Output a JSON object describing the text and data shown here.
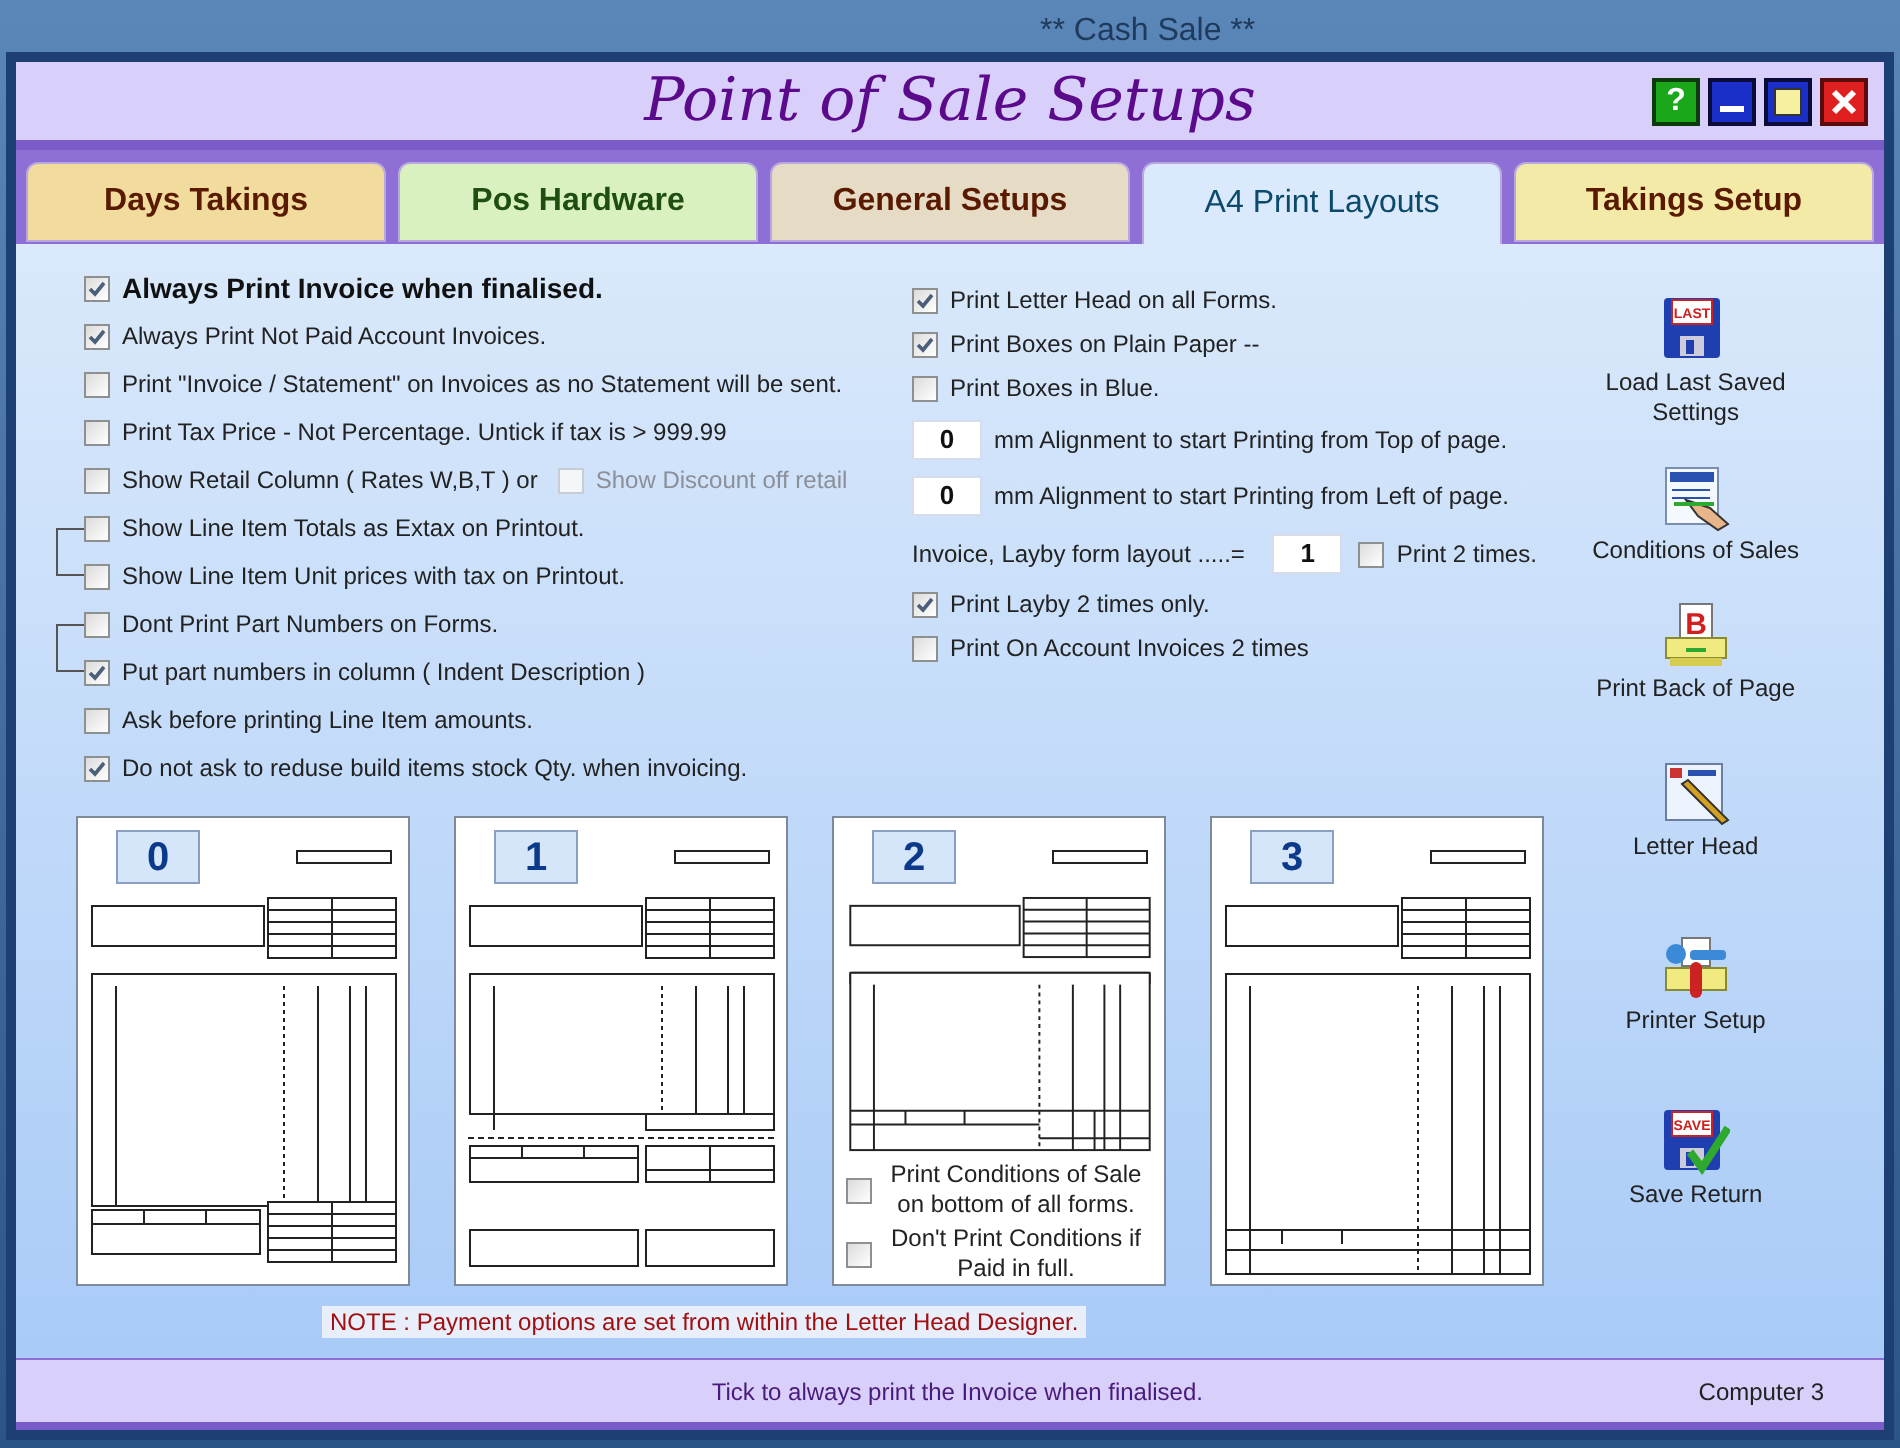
{
  "background_window": {
    "title": "** Cash Sale **"
  },
  "window": {
    "title": "Point of Sale Setups",
    "help_glyph": "?"
  },
  "tabs": [
    {
      "label": "Days Takings",
      "selected": false,
      "color": "#f1dc9e"
    },
    {
      "label": "Pos Hardware",
      "selected": false,
      "color": "#d9f0c0"
    },
    {
      "label": "General Setups",
      "selected": false,
      "color": "#e6dcc6"
    },
    {
      "label": "A4 Print Layouts",
      "selected": true,
      "color": "#dae9fb"
    },
    {
      "label": "Takings Setup",
      "selected": false,
      "color": "#f4eaa8"
    }
  ],
  "left_options": [
    {
      "kind": "heading",
      "label": "Always Print Invoice when finalised.",
      "checked": true
    },
    {
      "kind": "option",
      "label": "Always Print Not Paid Account Invoices.",
      "checked": true
    },
    {
      "kind": "option",
      "label": "Print \"Invoice / Statement\" on Invoices as no Statement will be sent.",
      "checked": false
    },
    {
      "kind": "option",
      "label": "Print Tax Price - Not Percentage.  Untick if tax is > 999.99",
      "checked": false
    },
    {
      "kind": "option",
      "label": "Show Retail Column ( Rates W,B,T ) or",
      "checked": false,
      "sub": {
        "label": "Show Discount off retail",
        "checked": false,
        "disabled": true
      }
    },
    {
      "kind": "linked",
      "options": [
        {
          "label": "Show Line Item Totals as Extax on Printout.",
          "checked": false
        },
        {
          "label": "Show Line Item Unit prices with tax on Printout.",
          "checked": false
        }
      ]
    },
    {
      "kind": "linked",
      "options": [
        {
          "label": "Dont Print Part Numbers on Forms.",
          "checked": false
        },
        {
          "label": "Put part numbers in column ( Indent Description )",
          "checked": true
        }
      ]
    },
    {
      "kind": "option",
      "label": "Ask before printing Line Item amounts.",
      "checked": false
    },
    {
      "kind": "option",
      "label": "Do not ask to reduse build items stock Qty. when invoicing.",
      "checked": true
    }
  ],
  "right_options": [
    {
      "kind": "check",
      "label": "Print Letter Head on all Forms.",
      "checked": true
    },
    {
      "kind": "check",
      "label": "Print Boxes on Plain Paper --",
      "checked": true
    },
    {
      "kind": "check",
      "label": "Print Boxes in Blue.",
      "checked": false
    },
    {
      "kind": "mm",
      "value": "0",
      "label": "mm  Alignment to start Printing from Top of page."
    },
    {
      "kind": "mm",
      "value": "0",
      "label": "mm  Alignment to start Printing from Left of page."
    },
    {
      "kind": "layout",
      "label": "Invoice, Layby form layout .....=",
      "value": "1",
      "check": {
        "label": "Print 2 times.",
        "checked": false
      }
    },
    {
      "kind": "check",
      "label": "Print Layby 2 times only.",
      "checked": true
    },
    {
      "kind": "check",
      "label": "Print On Account Invoices 2 times",
      "checked": false
    }
  ],
  "layouts": [
    {
      "number": "0",
      "kind": "full"
    },
    {
      "number": "1",
      "kind": "split"
    },
    {
      "number": "2",
      "kind": "short",
      "options": [
        {
          "label": "Print Conditions of Sale on bottom of all forms.",
          "checked": false
        },
        {
          "label": "Don't Print Conditions if Paid in full.",
          "checked": false
        }
      ]
    },
    {
      "number": "3",
      "kind": "tall"
    }
  ],
  "note": "NOTE : Payment options are set from within the Letter Head Designer.",
  "side_buttons": [
    {
      "kind": "load",
      "label": "Load Last Saved Settings",
      "icon_text": "LAST"
    },
    {
      "kind": "conditions",
      "label": "Conditions of Sales"
    },
    {
      "kind": "back",
      "label": "Print Back of Page",
      "icon_text": "B"
    },
    {
      "kind": "letterhead",
      "label": "Letter Head"
    },
    {
      "kind": "printer",
      "label": "Printer Setup"
    },
    {
      "kind": "save",
      "label": "Save Return",
      "icon_text": "SAVE"
    }
  ],
  "status_bar": {
    "message": "Tick to always print the Invoice when finalised.",
    "computer": "Computer 3"
  }
}
